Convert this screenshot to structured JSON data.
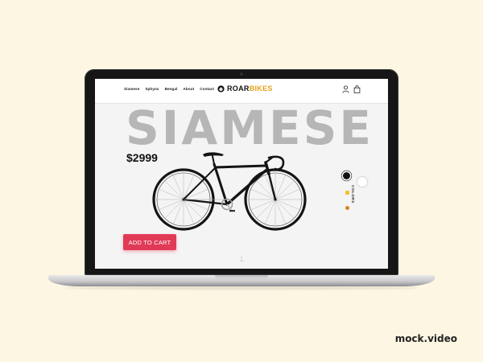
{
  "nav": {
    "links": [
      "Siamese",
      "Sphynx",
      "Bengal",
      "About",
      "Contact"
    ]
  },
  "brand": {
    "roar": "ROAR",
    "bikes": "BIKES"
  },
  "product": {
    "title": "SIAMESE",
    "price": "$2999",
    "colors_label": "COLORS",
    "cta_label": "ADD TO CART"
  },
  "watermark": "mock.video",
  "colors": {
    "background": "#fdf6e3",
    "accent": "#e03a57",
    "brand_yellow": "#e8a21b",
    "swatches": [
      "#111111",
      "#ffffff",
      "#f2c230",
      "#d4861c"
    ]
  },
  "icons": [
    "user-icon",
    "cart-icon",
    "lion-logo-icon",
    "scroll-down-icon"
  ]
}
